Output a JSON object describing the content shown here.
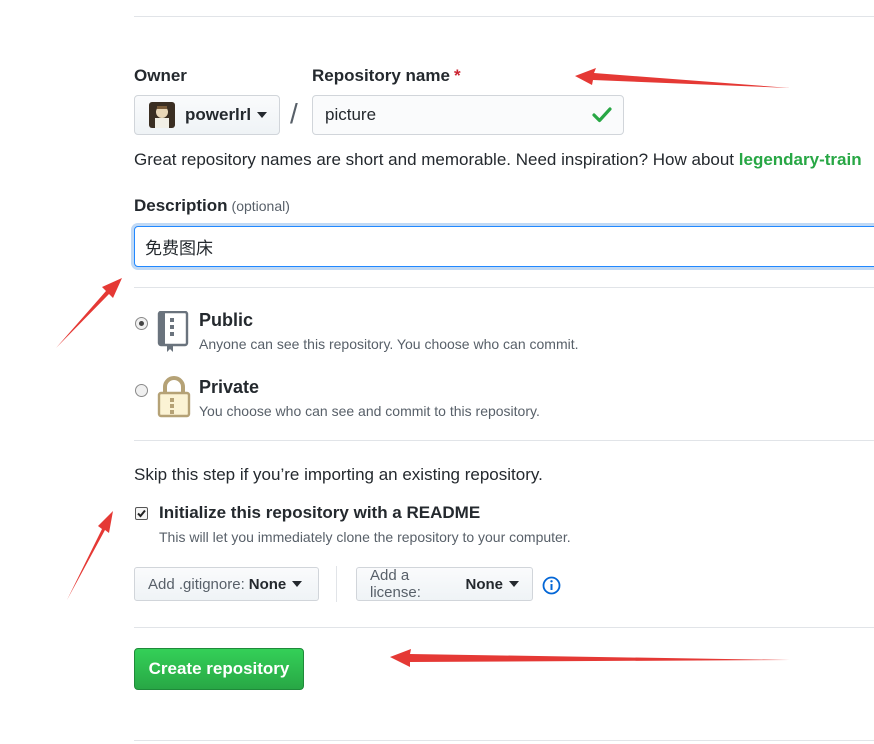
{
  "owner": {
    "label": "Owner",
    "username": "powerlrl"
  },
  "repo_name": {
    "label": "Repository name",
    "required_mark": "*",
    "separator": "/",
    "value": "picture"
  },
  "help": {
    "text": "Great repository names are short and memorable. Need inspiration? How about ",
    "suggestion": "legendary-train"
  },
  "description": {
    "label": "Description",
    "optional": "(optional)",
    "value": "免费图床"
  },
  "visibility": {
    "public": {
      "title": "Public",
      "note": "Anyone can see this repository. You choose who can commit.",
      "selected": true
    },
    "private": {
      "title": "Private",
      "note": "You choose who can see and commit to this repository.",
      "selected": false
    }
  },
  "init": {
    "skip_text": "Skip this step if you’re importing an existing repository.",
    "readme_label": "Initialize this repository with a README",
    "readme_note": "This will let you immediately clone the repository to your computer.",
    "readme_checked": true,
    "gitignore_key": "Add .gitignore:",
    "gitignore_value": "None",
    "license_key": "Add a license:",
    "license_value": "None"
  },
  "create_button": "Create repository",
  "colors": {
    "accent_green": "#28a745",
    "annotation_red": "#e53935",
    "focus_blue": "#2188ff"
  }
}
